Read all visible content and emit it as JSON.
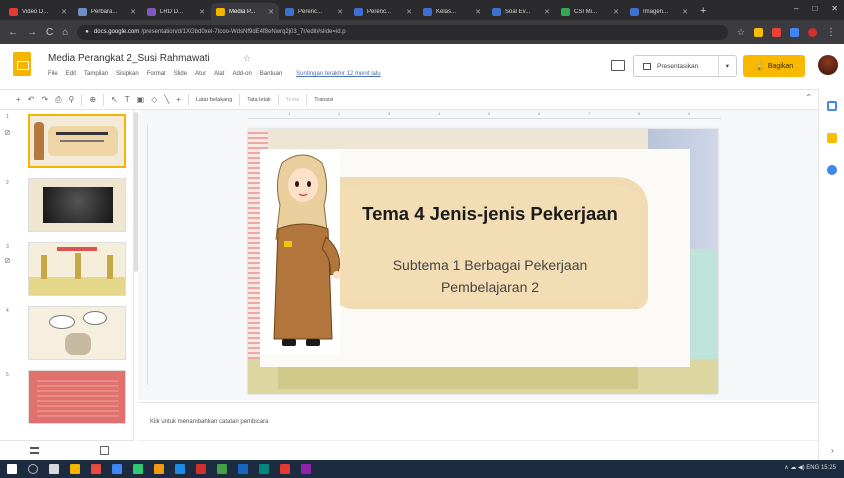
{
  "browser": {
    "tabs": [
      {
        "label": "Video D...",
        "color": "#e53935",
        "active": false
      },
      {
        "label": "Perbara...",
        "color": "#6f8fc5",
        "active": false
      },
      {
        "label": "LRD D...",
        "color": "#7e57c2",
        "active": false
      },
      {
        "label": "Media P...",
        "color": "#f4b400",
        "active": true
      },
      {
        "label": "Perenc...",
        "color": "#3f6fd1",
        "active": false
      },
      {
        "label": "Perenc...",
        "color": "#3f6fd1",
        "active": false
      },
      {
        "label": "Kelas...",
        "color": "#3f6fd1",
        "active": false
      },
      {
        "label": "Soal Ev...",
        "color": "#3f6fd1",
        "active": false
      },
      {
        "label": "CSI Mi...",
        "color": "#34a853",
        "active": false
      },
      {
        "label": "Imagen...",
        "color": "#3f6fd1",
        "active": false
      }
    ],
    "new_tab": "+",
    "window_controls": {
      "minimize": "–",
      "maximize": "□",
      "close": "✕"
    },
    "url_host": "docs.google.com",
    "url_rest": "/presentation/d/1XGbd0xel-7tcoo-WdsNf9dE4f8eNwrq2j03_7r/edit#slide=id.p",
    "nav": {
      "back": "←",
      "forward": "→",
      "reload": "C",
      "home": "⌂"
    },
    "extension_colors": [
      "#fbbc05",
      "#ea4335",
      "#4285f4",
      "#5f6368"
    ]
  },
  "doc": {
    "title": "Media Perangkat 2_Susi Rahmawati",
    "star": "☆",
    "menus": [
      "File",
      "Edit",
      "Tampilan",
      "Sisipkan",
      "Format",
      "Slide",
      "Atur",
      "Alat",
      "Add-on",
      "Bantuan"
    ],
    "last_edit": "Suntingan terakhir 12 menit lalu",
    "present_label": "Presentasikan",
    "present_caret": "▾",
    "share_label": "Bagikan",
    "share_icon": "🔒",
    "brand_color": "#f4b400"
  },
  "toolbar": {
    "new_slide": "+",
    "undo": "↶",
    "redo": "↷",
    "print": "⎙",
    "paint_format": "⚲",
    "zoom": "⊕",
    "select": "↖",
    "textbox": "T",
    "image": "▣",
    "shape": "◇",
    "line": "╲",
    "comment": "+",
    "background": "Latar belakang",
    "layout": "Tata letak",
    "theme_muted": "Tema",
    "transition": "Transisi",
    "collapse": "⌃"
  },
  "side_panel": {
    "icons": [
      {
        "name": "calendar-icon",
        "color": "#4285f4"
      },
      {
        "name": "keep-icon",
        "color": "#fbbc05"
      },
      {
        "name": "tasks-icon",
        "color": "#4285f4"
      }
    ],
    "scroll": "›"
  },
  "filmstrip": {
    "slides": [
      {
        "num": "1",
        "selected": true
      },
      {
        "num": "2",
        "selected": false
      },
      {
        "num": "3",
        "selected": false
      },
      {
        "num": "4",
        "selected": false
      },
      {
        "num": "5",
        "selected": false
      }
    ],
    "link_icon": "⊘"
  },
  "slide": {
    "title": "Tema 4 Jenis-jenis Pekerjaan",
    "subtitle1": "Subtema 1 Berbagai Pekerjaan",
    "subtitle2": "Pembelajaran 2"
  },
  "notes": {
    "placeholder": "Klik untuk menambahkan catatan pembicara"
  },
  "ruler": [
    "1",
    "2",
    "3",
    "4",
    "5",
    "6",
    "7",
    "8",
    "9"
  ],
  "taskbar": {
    "icons": [
      "#ffffff",
      "#8aa4c8",
      "#d9d9d9",
      "#f4b400",
      "#e74c3c",
      "#4285f4",
      "#2ecc71",
      "#f39c12",
      "#1e88e5",
      "#d32f2f",
      "#43a047",
      "#1565c0",
      "#00897b",
      "#e53935",
      "#8e24aa",
      "#fbc02d"
    ],
    "tray": "∧  ☁  ◀)  ENG  15:25"
  }
}
